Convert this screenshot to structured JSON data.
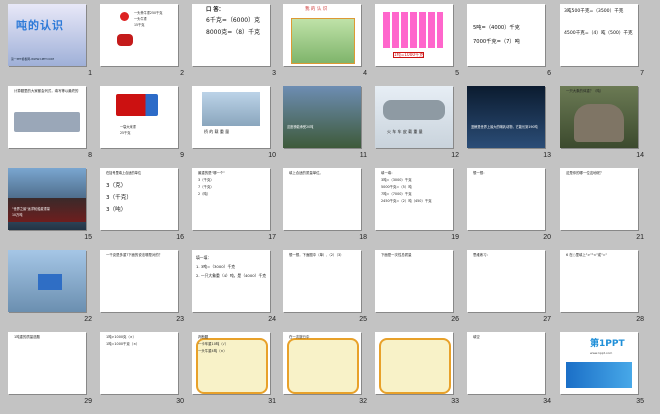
{
  "slides": [
    {
      "n": "1",
      "title": "吨的认识",
      "foot": "第一PPT模板网-WWW.1PPT.COM"
    },
    {
      "n": "2",
      "lines": [
        "一头黄牛重250千克",
        "一头牛重",
        "15千克"
      ]
    },
    {
      "n": "3",
      "header": "口 答：",
      "lines": [
        "6千克=（6000）克",
        "8000克=（8）千克"
      ]
    },
    {
      "n": "4",
      "title": "我 的 认 识"
    },
    {
      "n": "5",
      "lines": [
        "1吨=1000千克"
      ]
    },
    {
      "n": "6",
      "lines": [
        "5吨=（4000）千克",
        "7000千克=（7）吨"
      ]
    },
    {
      "n": "7",
      "lines": [
        "3吨500千克=（3500）千克",
        "4500千克=（4）吨（500）千克"
      ]
    },
    {
      "n": "8",
      "lines": [
        "计算题里的大家都会列式，填写等以最终的"
      ]
    },
    {
      "n": "9",
      "lines": [
        "一袋大米重",
        "25千克"
      ]
    },
    {
      "n": "10",
      "lines": [
        "桥 的 载 重 量"
      ]
    },
    {
      "n": "11",
      "lines": [
        "这座桥能承受20吨"
      ]
    },
    {
      "n": "12",
      "lines": [
        "火 车 车 皮 载 重 量"
      ]
    },
    {
      "n": "13",
      "lines": [
        "蓝鲸是世界上最大的哺乳动物，它能长到190吨"
      ]
    },
    {
      "n": "14",
      "lines": [
        "一只大象的体重？（吨）"
      ]
    },
    {
      "n": "15",
      "lines": [
        "\"世界之最\"远洋轮船载重量",
        "10万吨"
      ]
    },
    {
      "n": "16",
      "lines": [
        "在括号里填上合适的单位",
        "3（克）",
        "3（千克）",
        "3（吨）"
      ]
    },
    {
      "n": "17",
      "lines": [
        "最重的是\"哪一个\"",
        "3（千克）",
        "7（千克）",
        "2（吨）"
      ]
    },
    {
      "n": "18",
      "lines": [
        "填上合适的质量单位。"
      ]
    },
    {
      "n": "19",
      "lines": [
        "填一填：",
        "3吨=（3000）千克",
        "5000千克=（5）吨",
        "7吨=（7000）千克",
        "2450千克=（2）吨（450）千克"
      ]
    },
    {
      "n": "20",
      "lines": [
        "想一想："
      ]
    },
    {
      "n": "21",
      "lines": [
        "这是你的哪一位这地呢？"
      ]
    },
    {
      "n": "22",
      "lines": []
    },
    {
      "n": "23",
      "lines": [
        "一千克是多重?下面的说法哪是对的？"
      ]
    },
    {
      "n": "24",
      "lines": [
        "填一填：",
        "1. 3吨=（3000）千克",
        "2. 一只大象重（4）吨，是（4000）千克"
      ]
    },
    {
      "n": "25",
      "lines": [
        "想一想，下面图中（单）,（2）（3）"
      ]
    },
    {
      "n": "26",
      "lines": [
        "下面是一次性总质量"
      ]
    },
    {
      "n": "27",
      "lines": [
        "思维练习："
      ]
    },
    {
      "n": "28",
      "lines": [
        "6 在○里填上\">\"\"<\"或\"=\""
      ]
    },
    {
      "n": "29",
      "lines": [
        "1吨重的质量选题"
      ]
    },
    {
      "n": "30",
      "lines": [
        "1吨>1000克（×）",
        "1吨=1000千克（×）"
      ]
    },
    {
      "n": "31",
      "lines": [
        "判断题",
        "一卡车重10吨（√）",
        "一头牛重4吨（×）"
      ]
    },
    {
      "n": "32",
      "lines": [
        "在一次旅行中"
      ]
    },
    {
      "n": "33",
      "lines": []
    },
    {
      "n": "34",
      "lines": [
        "填空"
      ]
    },
    {
      "n": "35",
      "lines": [
        "第1PPT",
        "www.1ppt.com"
      ]
    }
  ],
  "colors": {
    "background": "#c3c3c3",
    "slide": "#ffffff",
    "red": "#cc1f1f",
    "blue": "#1a4aa8"
  }
}
